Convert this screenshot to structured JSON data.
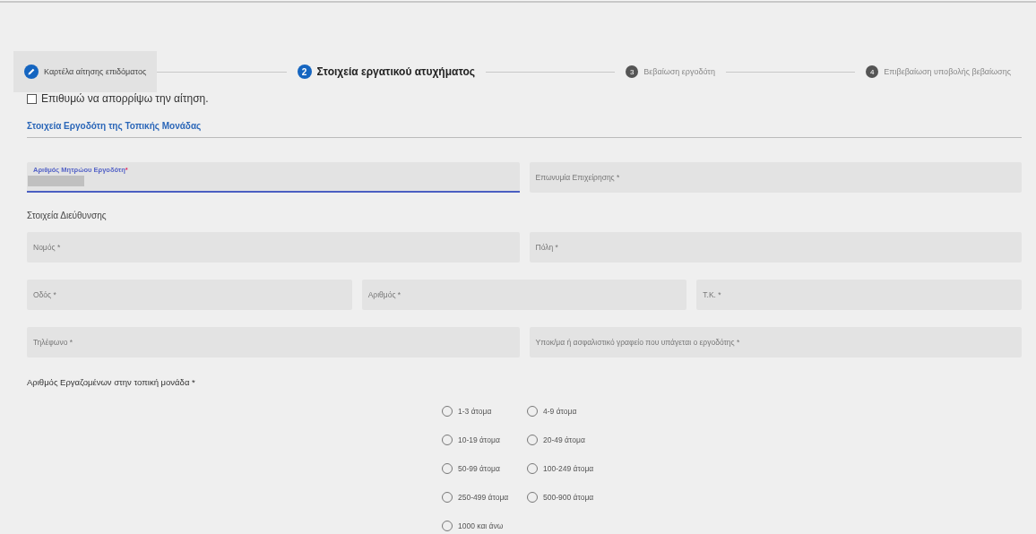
{
  "steps": [
    {
      "label": "Καρτέλα αίτησης επιδόματος",
      "kind": "completed"
    },
    {
      "number": "2",
      "label": "Στοιχεία εργατικού ατυχήματος",
      "kind": "active"
    },
    {
      "number": "3",
      "label": "Βεβαίωση εργοδότη",
      "kind": "pending"
    },
    {
      "number": "4",
      "label": "Επιβεβαίωση υποβολής βεβαίωσης",
      "kind": "pending"
    }
  ],
  "reject_checkbox": {
    "label": "Επιθυμώ να απορρίψω την αίτηση.",
    "checked": false
  },
  "section_title": "Στοιχεία Εργοδότη της Τοπικής Μονάδας",
  "employer_fields": [
    {
      "label": "Αριθμός Μητρώου Εργοδότη",
      "required_mark": "*",
      "focused": true,
      "redacted": true
    },
    {
      "label": "Επωνυμία Επιχείρησης *",
      "focused": false
    }
  ],
  "address_title": "Στοιχεία Διεύθυνσης",
  "address_rows": [
    [
      {
        "label": "Νομός *",
        "focused": false
      },
      {
        "label": "Πόλη *",
        "focused": false
      }
    ],
    [
      {
        "label": "Οδός *",
        "focused": false
      },
      {
        "label": "Αριθμός *",
        "focused": false
      },
      {
        "label": "Τ.Κ. *",
        "focused": false
      }
    ],
    [
      {
        "label": "Τηλέφωνο *",
        "focused": false
      },
      {
        "label": "Υποκ/μα ή ασφαλιστικό γραφείο που υπάγεται ο εργοδότης *",
        "focused": false
      }
    ]
  ],
  "employees": {
    "label": "Αριθμός Εργαζομένων στην τοπική μονάδα *",
    "options": [
      {
        "label": "1-3 άτομα",
        "selected": false
      },
      {
        "label": "4-9 άτομα",
        "selected": false
      },
      {
        "label": "10-19 άτομα",
        "selected": false
      },
      {
        "label": "20-49 άτομα",
        "selected": false
      },
      {
        "label": "50-99 άτομα",
        "selected": false
      },
      {
        "label": "100-249 άτομα",
        "selected": false
      },
      {
        "label": "250-499 άτομα",
        "selected": false
      },
      {
        "label": "500-900 άτομα",
        "selected": false
      },
      {
        "label": "1000 και άνω",
        "selected": false
      }
    ]
  }
}
